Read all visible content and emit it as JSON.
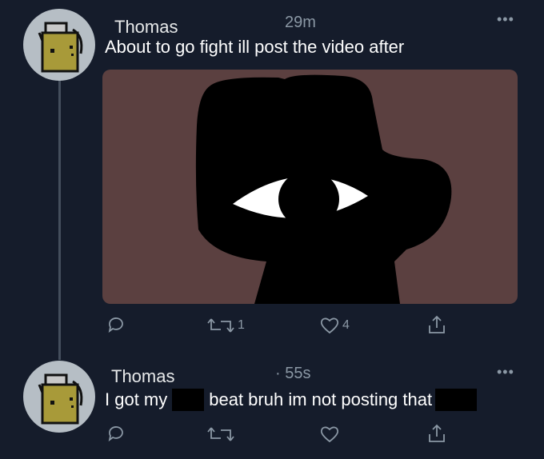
{
  "tweets": [
    {
      "author": "Thomas",
      "time": "29m",
      "text": "About to go fight ill post the video after",
      "actions": {
        "retweets": "1",
        "likes": "4"
      }
    },
    {
      "author": "Thomas",
      "time": "· 55s",
      "text_part1": "I got my",
      "text_part2": "beat bruh im not posting that"
    }
  ],
  "icons": [
    "more-icon",
    "reply-icon",
    "retweet-icon",
    "like-icon",
    "share-icon"
  ],
  "colors": {
    "background": "#151c2b",
    "media_bg": "#5b4040",
    "avatar_bg": "#b6bec5",
    "avatar_face": "#a89a39"
  }
}
